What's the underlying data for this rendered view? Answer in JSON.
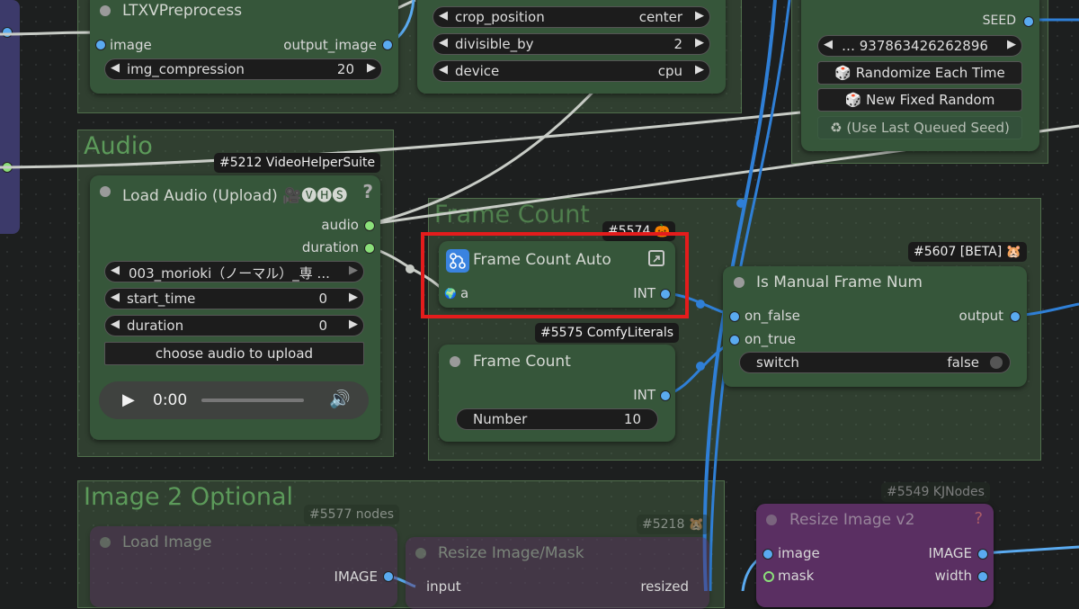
{
  "colors": {
    "canvas_bg": "#1d1f1f",
    "group_green": "#5c9a5a",
    "node_green": "#36563a",
    "node_purple": "#5a2f62",
    "wire_blue": "#2f7fd6",
    "wire_grey": "#c8ccc6",
    "highlight_red": "#e41c1c",
    "socket_green": "#8be07a",
    "socket_blue": "#5aaaf0"
  },
  "groups": {
    "audio": {
      "title": "Audio"
    },
    "frame_count": {
      "title": "Frame Count"
    },
    "image2": {
      "title": "Image 2 Optional"
    }
  },
  "ltxv": {
    "title": "LTXVPreprocess",
    "input_image": "image",
    "output_image": "output_image",
    "img_compression_label": "img_compression",
    "img_compression_value": "20"
  },
  "crop": {
    "crop_position_label": "crop_position",
    "crop_position_value": "center",
    "divisible_by_label": "divisible_by",
    "divisible_by_value": "2",
    "device_label": "device",
    "device_value": "cpu"
  },
  "seed": {
    "output_label": "SEED",
    "seed_value": "… 937863426262896",
    "randomize_label": "Randomize Each Time",
    "randomize_icon": "dice-icon",
    "new_fixed_label": "New Fixed Random",
    "new_fixed_icon": "dice-icon",
    "last_queued_label": "(Use Last Queued Seed)",
    "last_queued_icon": "recycle-icon"
  },
  "load_audio": {
    "badge": "#5212 VideoHelperSuite",
    "title": "Load Audio (Upload) 🎥🅥🅗🅢",
    "help": "?",
    "out_audio": "audio",
    "out_duration": "duration",
    "file_value": "003_morioki（ノーマル）_専 ...",
    "start_time_label": "start_time",
    "start_time_value": "0",
    "duration_label": "duration",
    "duration_value": "0",
    "upload_label": "choose audio to upload",
    "player_time": "0:00"
  },
  "frame_count_auto": {
    "badge": "#5574 🎃",
    "title": "Frame Count Auto",
    "input_a": "a",
    "output_int": "INT"
  },
  "frame_count": {
    "badge": "#5575 ComfyLiterals",
    "title": "Frame Count",
    "output_int": "INT",
    "number_label": "Number",
    "number_value": "10"
  },
  "manual_frame": {
    "badge": "#5607 [BETA] 🐹",
    "title": "Is Manual Frame Num",
    "in_false": "on_false",
    "in_true": "on_true",
    "output": "output",
    "switch_label": "switch",
    "switch_value": "false"
  },
  "image2": {
    "badge_nodes": "#5577 nodes",
    "badge_5218": "#5218 🐹",
    "badge_kj": "#5549 KJNodes",
    "load_image_title": "Load Image",
    "load_image_out": "IMAGE",
    "resize_mask_title": "Resize Image/Mask",
    "resize_mask_in": "input",
    "resize_mask_out": "resized",
    "resize_v2_title": "Resize Image v2",
    "resize_v2_help": "?",
    "resize_v2_in_image": "image",
    "resize_v2_in_mask": "mask",
    "resize_v2_out_image": "IMAGE",
    "resize_v2_out_width": "width"
  }
}
